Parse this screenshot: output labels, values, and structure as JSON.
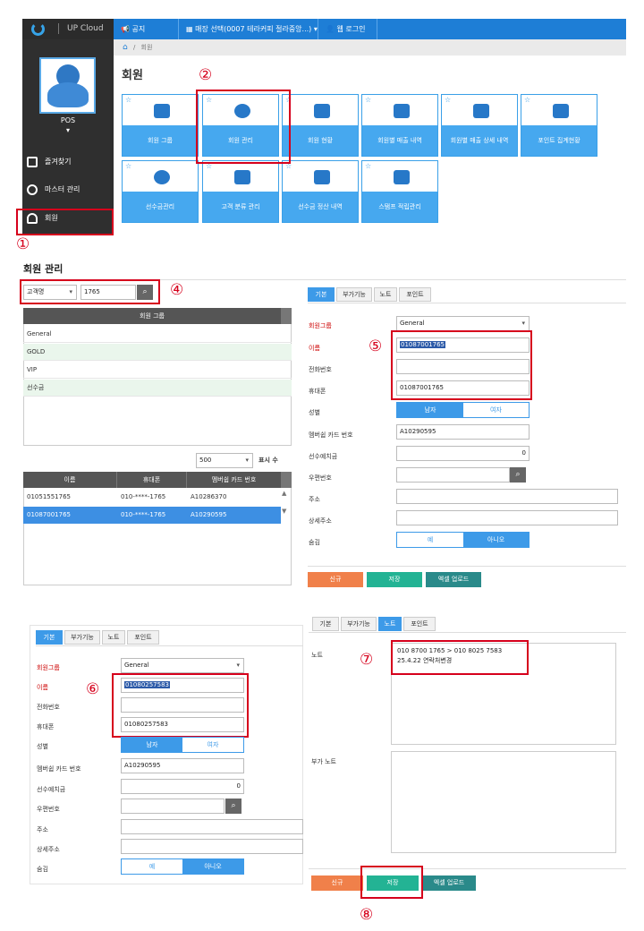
{
  "app": {
    "title": "UP Cloud"
  },
  "topbar": {
    "notice": "공지",
    "store": "매장 선택(0007 테라커피 절라중앙...)",
    "login": "웹 로그인"
  },
  "breadcrumb": {
    "home": "⌂",
    "sep": "/",
    "current": "회원"
  },
  "sidebar": {
    "user": "POS",
    "user_arrow": "▾",
    "items": [
      {
        "label": "즐겨찾기"
      },
      {
        "label": "마스터 관리"
      },
      {
        "label": "회원"
      }
    ]
  },
  "page": {
    "title": "회원"
  },
  "tiles": [
    {
      "label": "회원 그룹"
    },
    {
      "label": "회원 관리"
    },
    {
      "label": "회원 현황"
    },
    {
      "label": "회원별 매출 내역"
    },
    {
      "label": "회원별 매출 상세 내역"
    },
    {
      "label": "포인트 집계현황"
    },
    {
      "label": "선수금관리"
    },
    {
      "label": "고객 분류 관리"
    },
    {
      "label": "선수금 정산 내역"
    },
    {
      "label": "스탬프 적립관리"
    }
  ],
  "tile_star": "☆",
  "annotations": [
    "①",
    "②",
    "④",
    "⑤",
    "⑥",
    "⑦",
    "⑧"
  ],
  "member": {
    "title": "회원 관리",
    "search": {
      "type": "고객명",
      "value": "1765",
      "icon": "⌕"
    },
    "group_header": "회원 그룹",
    "groups": [
      "General",
      "GOLD",
      "VIP",
      "선수금"
    ],
    "page_size": "500",
    "page_size_label": "표시 수",
    "list_headers": [
      "이름",
      "휴대폰",
      "멤버쉽 카드 번호"
    ],
    "list_rows": [
      {
        "name": "01051551765",
        "phone": "010-****-1765",
        "card": "A10286370"
      },
      {
        "name": "01087001765",
        "phone": "010-****-1765",
        "card": "A10290595"
      }
    ]
  },
  "tabs": [
    "기본",
    "부가기능",
    "노트",
    "포인트"
  ],
  "labels": {
    "group": "회원그룹",
    "name": "이름",
    "tel": "전화번호",
    "mobile": "휴대폰",
    "gender": "성별",
    "card": "멤버쉽 카드 번호",
    "prepaid": "선수예치금",
    "zip": "우편번호",
    "addr": "주소",
    "addr2": "상세주소",
    "hide": "숨김",
    "note": "노트",
    "extra_note": "부가 노트"
  },
  "form1": {
    "group": "General",
    "name": "01087001765",
    "mobile": "01087001765",
    "card": "A10290595",
    "prepaid": "0"
  },
  "form2": {
    "group": "General",
    "name": "01080257583",
    "mobile": "01080257583",
    "card": "A10290595",
    "prepaid": "0"
  },
  "gender": {
    "male": "남자",
    "female": "여자"
  },
  "hide_opts": {
    "yes": "예",
    "no": "아니오"
  },
  "note": {
    "line1": "010 8700 1765 > 010 8025 7583",
    "line2": "25.4.22 연락처변경"
  },
  "buttons": {
    "new": "신규",
    "save": "저장",
    "excel": "엑셀 업로드"
  },
  "colors": {
    "accent": "#3d9ae8",
    "new": "#f0804a",
    "save": "#23b394",
    "excel": "#2a8a8a",
    "annotation": "#d6001c"
  }
}
